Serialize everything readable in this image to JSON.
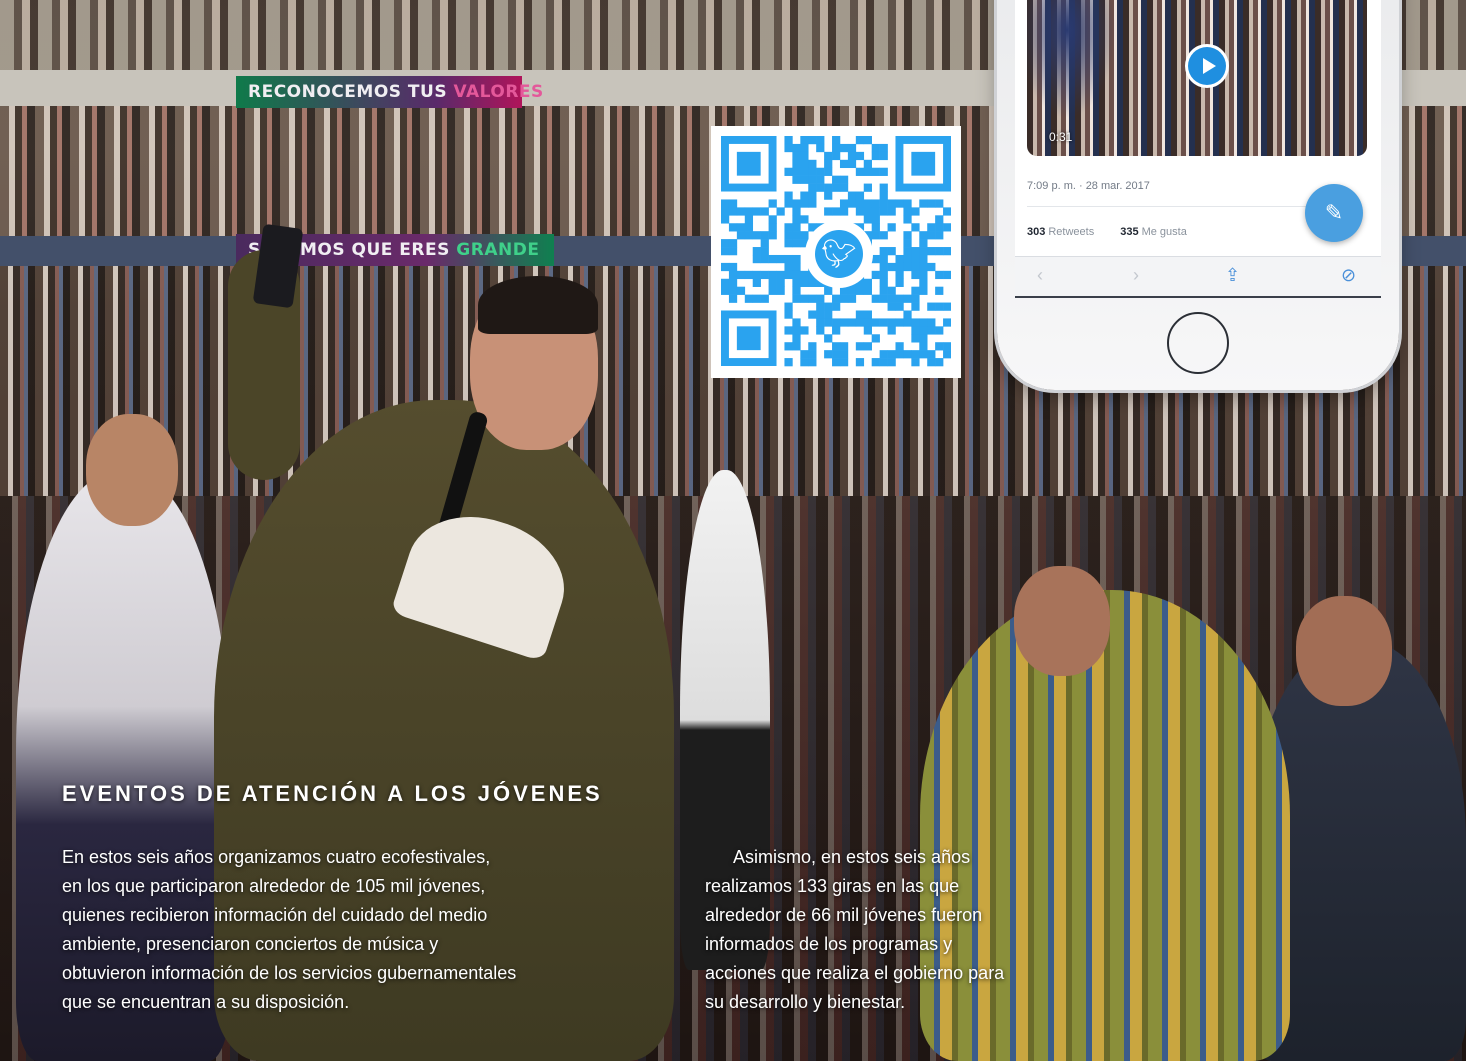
{
  "banners": {
    "top": {
      "text": "RECONOCEMOS TUS",
      "highlight": "VALORES"
    },
    "middle": {
      "text": "SABEMOS QUE ERES",
      "highlight": "GRANDE"
    }
  },
  "tweet": {
    "video_duration": "0:31",
    "timestamp": "7:09 p. m. · 28 mar. 2017",
    "retweets_count": "303",
    "retweets_label": "Retweets",
    "likes_count": "335",
    "likes_label": "Me gusta"
  },
  "icons": [
    "twitter-bird-icon",
    "play-icon",
    "compose-icon",
    "back-icon",
    "forward-icon",
    "share-icon",
    "compass-icon"
  ],
  "colors": {
    "twitter_blue": "#2aa3ef",
    "fab_blue": "#4a9fe0",
    "qr_blue": "#2aa3ef"
  },
  "article": {
    "heading": "EVENTOS DE ATENCIÓN A LOS JÓVENES",
    "paragraph_1": [
      "En estos seis años organizamos cuatro ecofestivales,",
      "en los que participaron alrededor de 105 mil jóvenes,",
      "quienes recibieron información del cuidado del medio",
      "ambiente, presenciaron conciertos de música y",
      "obtuvieron información de los servicios gubernamentales",
      "que se encuentran a su disposición."
    ],
    "paragraph_2": [
      "Asimismo, en estos seis años",
      "realizamos 133 giras en las que",
      "alrededor de 66 mil jóvenes fueron",
      "informados de los programas y",
      "acciones que realiza el gobierno para",
      "su desarrollo y bienestar."
    ]
  }
}
